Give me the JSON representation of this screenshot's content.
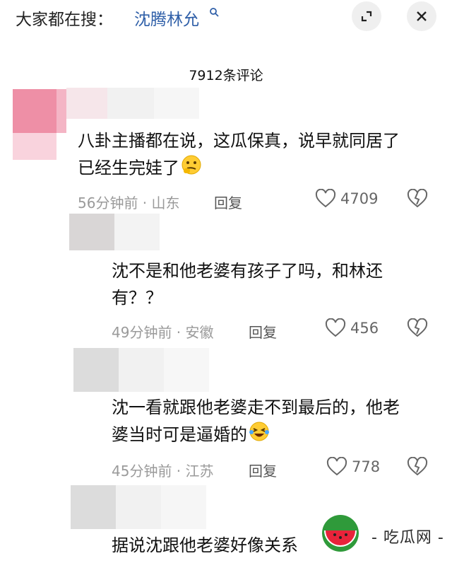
{
  "header": {
    "search_prefix": "大家都在搜：",
    "search_term": "沈腾林允",
    "expand_icon": "expand-icon",
    "close_icon": "close-icon"
  },
  "comment_count": "7912条评论",
  "comments": [
    {
      "text_line1": "八卦主播都在说，这瓜保真，说早就同居了",
      "text_line2": "已经生完娃了",
      "emoji": "thinking-face",
      "meta": "56分钟前 · 山东",
      "reply": "回复",
      "likes": "4709"
    },
    {
      "text_line1": "沈不是和他老婆有孩子了吗，和林还",
      "text_line2": "有？？",
      "meta": "49分钟前 · 安徽",
      "reply": "回复",
      "likes": "456"
    },
    {
      "text_line1": "沈一看就跟他老婆走不到最后的，他老",
      "text_line2": "婆当时可是逼婚的",
      "emoji": "laughing-tears-face",
      "meta": "45分钟前 · 江苏",
      "reply": "回复",
      "likes": "778"
    },
    {
      "text_line1": "据说沈跟他老婆好像关系"
    }
  ],
  "watermark": {
    "text": "- 吃瓜网 -",
    "logo": "watermelon-logo"
  },
  "colors": {
    "search_term": "#2f5fa8",
    "meta_gray": "#9a9a9a",
    "avatar_pink": "#ee8fa6"
  }
}
